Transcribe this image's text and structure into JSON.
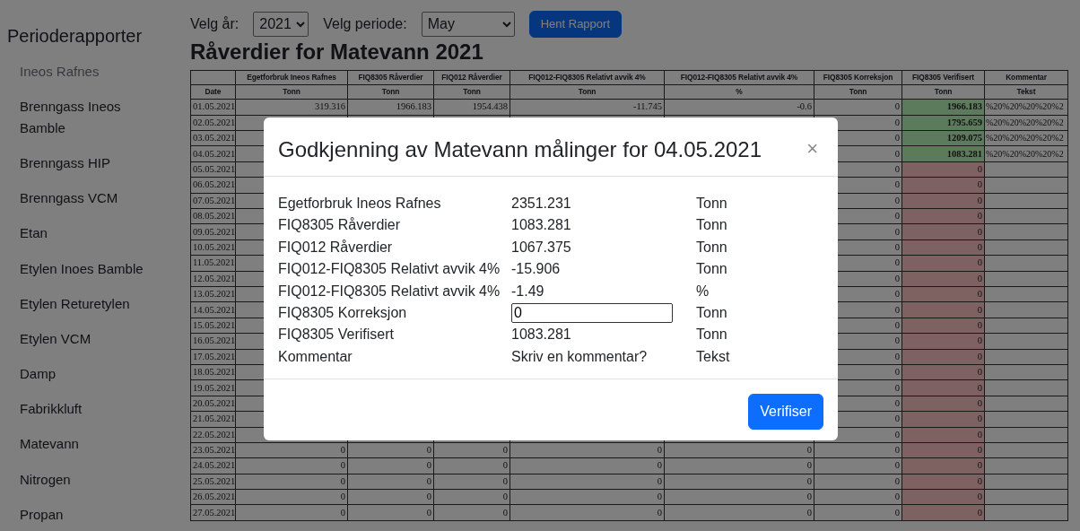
{
  "sidebar": {
    "title": "Perioderapporter",
    "items": [
      {
        "label": "Ineos Rafnes",
        "disabled": true
      },
      {
        "label": "Brenngass Ineos Bamble",
        "disabled": false
      },
      {
        "label": "Brenngass HIP",
        "disabled": false
      },
      {
        "label": "Brenngass VCM",
        "disabled": false
      },
      {
        "label": "Etan",
        "disabled": false
      },
      {
        "label": "Etylen Inoes Bamble",
        "disabled": false
      },
      {
        "label": "Etylen Returetylen",
        "disabled": false
      },
      {
        "label": "Etylen VCM",
        "disabled": false
      },
      {
        "label": "Damp",
        "disabled": false
      },
      {
        "label": "Fabrikkluft",
        "disabled": false
      },
      {
        "label": "Matevann",
        "disabled": false
      },
      {
        "label": "Nitrogen",
        "disabled": false
      },
      {
        "label": "Propan",
        "disabled": false
      }
    ]
  },
  "filters": {
    "year_label": "Velg år:",
    "year": "2021",
    "period_label": "Velg periode:",
    "period": "May",
    "button": "Hent Rapport"
  },
  "heading": "Råverdier for Matevann 2021",
  "table": {
    "columns": [
      {
        "unit": "Date"
      },
      {
        "name": "Egetforbruk Ineos Rafnes",
        "unit": "Tonn"
      },
      {
        "name": "FIQ8305 Råverdier",
        "unit": "Tonn"
      },
      {
        "name": "FIQ012 Råverdier",
        "unit": "Tonn"
      },
      {
        "name": "FIQ012-FIQ8305 Relativt avvik 4%",
        "unit": "Tonn"
      },
      {
        "name": "FIQ012-FIQ8305 Relativt avvik 4%",
        "unit": "%"
      },
      {
        "name": "FIQ8305 Korreksjon",
        "unit": "Tonn"
      },
      {
        "name": "FIQ8305 Verifisert",
        "unit": "Tonn"
      },
      {
        "name": "Kommentar",
        "unit": "Tekst"
      }
    ],
    "rows": [
      {
        "cells": [
          "01.05.2021",
          "319.316",
          "1966.183",
          "1954.438",
          "-11.745",
          "-0.6",
          "0",
          "1966.183",
          "%20%20%20%20%2"
        ],
        "verified": true
      },
      {
        "cells": [
          "02.05.2021",
          null,
          null,
          null,
          null,
          null,
          "0",
          "1795.659",
          "%20%20%20%20%2"
        ],
        "verified": true
      },
      {
        "cells": [
          "03.05.2021",
          null,
          null,
          null,
          null,
          null,
          "0",
          "1209.075",
          "%20%20%20%20%2"
        ],
        "verified": true
      },
      {
        "cells": [
          "04.05.2021",
          null,
          null,
          null,
          null,
          null,
          "0",
          "1083.281",
          "%20%20%20%20%2"
        ],
        "verified": true
      },
      {
        "cells": [
          "05.05.2021",
          null,
          null,
          null,
          null,
          null,
          "0",
          "0",
          null
        ],
        "verified": false
      },
      {
        "cells": [
          "06.05.2021",
          null,
          null,
          null,
          null,
          null,
          "0",
          "0",
          null
        ],
        "verified": false
      },
      {
        "cells": [
          "07.05.2021",
          null,
          null,
          null,
          null,
          null,
          "0",
          "0",
          null
        ],
        "verified": false
      },
      {
        "cells": [
          "08.05.2021",
          null,
          null,
          null,
          null,
          null,
          "0",
          "0",
          null
        ],
        "verified": false
      },
      {
        "cells": [
          "09.05.2021",
          null,
          null,
          null,
          null,
          null,
          "0",
          "0",
          null
        ],
        "verified": false
      },
      {
        "cells": [
          "10.05.2021",
          null,
          null,
          null,
          null,
          null,
          "0",
          "0",
          null
        ],
        "verified": false
      },
      {
        "cells": [
          "11.05.2021",
          null,
          null,
          null,
          null,
          null,
          "0",
          "0",
          null
        ],
        "verified": false
      },
      {
        "cells": [
          "12.05.2021",
          null,
          null,
          null,
          null,
          null,
          "0",
          "0",
          null
        ],
        "verified": false
      },
      {
        "cells": [
          "13.05.2021",
          null,
          null,
          null,
          null,
          null,
          "0",
          "0",
          null
        ],
        "verified": false
      },
      {
        "cells": [
          "14.05.2021",
          null,
          null,
          null,
          null,
          null,
          "0",
          "0",
          null
        ],
        "verified": false
      },
      {
        "cells": [
          "15.05.2021",
          null,
          null,
          null,
          null,
          null,
          "0",
          "0",
          null
        ],
        "verified": false
      },
      {
        "cells": [
          "16.05.2021",
          null,
          null,
          null,
          null,
          null,
          "0",
          "0",
          null
        ],
        "verified": false
      },
      {
        "cells": [
          "17.05.2021",
          null,
          null,
          null,
          null,
          null,
          "0",
          "0",
          null
        ],
        "verified": false
      },
      {
        "cells": [
          "18.05.2021",
          null,
          null,
          null,
          null,
          null,
          "0",
          "0",
          null
        ],
        "verified": false
      },
      {
        "cells": [
          "19.05.2021",
          null,
          null,
          null,
          null,
          null,
          "0",
          "0",
          null
        ],
        "verified": false
      },
      {
        "cells": [
          "20.05.2021",
          null,
          null,
          null,
          null,
          null,
          "0",
          "0",
          null
        ],
        "verified": false
      },
      {
        "cells": [
          "21.05.2021",
          null,
          null,
          null,
          null,
          null,
          "0",
          "0",
          null
        ],
        "verified": false
      },
      {
        "cells": [
          "22.05.2021",
          null,
          null,
          null,
          null,
          null,
          "0",
          "0",
          null
        ],
        "verified": false
      },
      {
        "cells": [
          "23.05.2021",
          "0",
          "0",
          "0",
          "0",
          "0",
          "0",
          "0",
          null
        ],
        "verified": false
      },
      {
        "cells": [
          "24.05.2021",
          "0",
          "0",
          "0",
          "0",
          "0",
          "0",
          "0",
          null
        ],
        "verified": false
      },
      {
        "cells": [
          "25.05.2021",
          "0",
          "0",
          "0",
          "0",
          "0",
          "0",
          "0",
          null
        ],
        "verified": false
      },
      {
        "cells": [
          "26.05.2021",
          "0",
          "0",
          "0",
          "0",
          "0",
          "0",
          "0",
          null
        ],
        "verified": false
      },
      {
        "cells": [
          "27.05.2021",
          "0",
          "0",
          "0",
          "0",
          "0",
          "0",
          "0",
          null
        ],
        "verified": false
      }
    ]
  },
  "modal": {
    "title": "Godkjenning av Matevann målinger for 04.05.2021",
    "close": "×",
    "fields": [
      {
        "kind": "text",
        "label": "Egetforbruk Ineos Rafnes",
        "value": "2351.231",
        "unit": "Tonn"
      },
      {
        "kind": "text",
        "label": "FIQ8305 Råverdier",
        "value": "1083.281",
        "unit": "Tonn"
      },
      {
        "kind": "text",
        "label": "FIQ012 Råverdier",
        "value": "1067.375",
        "unit": "Tonn"
      },
      {
        "kind": "text",
        "label": "FIQ012-FIQ8305 Relativt avvik 4%",
        "value": "-15.906",
        "unit": "Tonn"
      },
      {
        "kind": "text",
        "label": "FIQ012-FIQ8305 Relativt avvik 4%",
        "value": "-1.49",
        "unit": "%"
      },
      {
        "kind": "number",
        "label": "FIQ8305 Korreksjon",
        "value": "0",
        "unit": "Tonn"
      },
      {
        "kind": "text",
        "label": "FIQ8305 Verifisert",
        "value": "1083.281",
        "unit": "Tonn"
      },
      {
        "kind": "text",
        "label": "Kommentar",
        "value": "Skriv en kommentar?",
        "unit": "Tekst"
      }
    ],
    "button": "Verifiser"
  }
}
